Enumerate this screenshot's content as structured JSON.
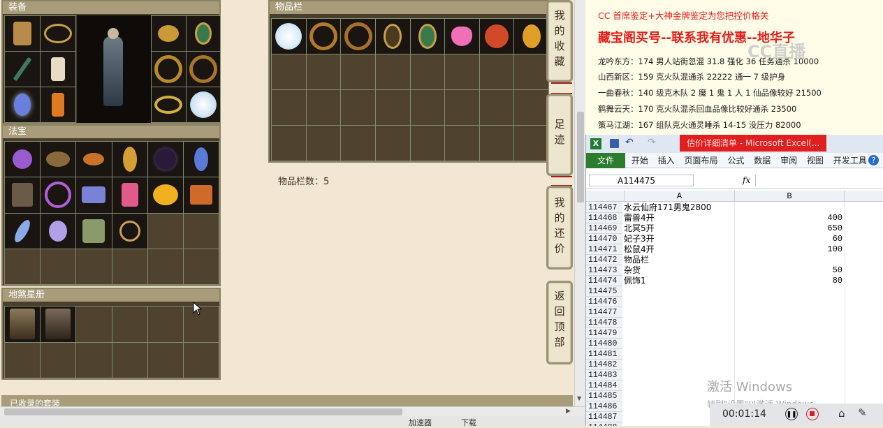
{
  "panels": {
    "equip": {
      "title": "装备"
    },
    "treasure": {
      "title": "法宝"
    },
    "star_book": {
      "title": "地煞星册"
    },
    "inventory": {
      "title": "物品栏",
      "count_text": "物品栏数：5"
    },
    "collected": {
      "title": "已收录的套装"
    }
  },
  "side_tabs": [
    {
      "label": "我\n的\n收\n藏"
    },
    {
      "label": "足\n迹"
    },
    {
      "label": "我\n的\n还\n价"
    },
    {
      "label": "返\n回\n顶\n部"
    }
  ],
  "doc": {
    "line_cc": "CC 首席鉴定+大神金牌鉴定为您把控价格关",
    "headline": "藏宝阁买号--联系我有优惠--地华子",
    "watermark": "CC直播",
    "entries": [
      "龙吟东方：174 男人站街忽混 31.8 强化 36 任务通杀 10000",
      "山西新区：159 克火队混通杀 22222 通一 7 级护身",
      "一曲春秋：140 级克木队 2 魔 1 鬼 1 人 1 仙品像较好 21500",
      "鹤舞云天：170 克火队混杀回血品像比较好通杀 23500",
      "策马江湖：167 组队克火通灵睡杀 14-15 没压力 82000"
    ]
  },
  "excel": {
    "title": "估价详细清单 - Microsoft Excel(...",
    "ribbon_tabs": [
      "开始",
      "插入",
      "页面布局",
      "公式",
      "数据",
      "审阅",
      "视图",
      "开发工具"
    ],
    "file_tab": "文件",
    "name_box": "A114475",
    "fx": "fx",
    "col_a": "A",
    "col_b": "B",
    "rows": [
      {
        "n": "114467",
        "a": "水云仙府171男鬼2800",
        "b": ""
      },
      {
        "n": "114468",
        "a": "雷兽4开",
        "b": "400"
      },
      {
        "n": "114469",
        "a": "北冥5开",
        "b": "650"
      },
      {
        "n": "114470",
        "a": "妃子3开",
        "b": "60"
      },
      {
        "n": "114471",
        "a": "松鼠4开",
        "b": "100"
      },
      {
        "n": "114472",
        "a": "物品栏",
        "b": ""
      },
      {
        "n": "114473",
        "a": "杂货",
        "b": "50"
      },
      {
        "n": "114474",
        "a": "佩饰1",
        "b": "80"
      },
      {
        "n": "114475",
        "a": "",
        "b": ""
      },
      {
        "n": "114476",
        "a": "",
        "b": ""
      },
      {
        "n": "114477",
        "a": "",
        "b": ""
      },
      {
        "n": "114478",
        "a": "",
        "b": ""
      },
      {
        "n": "114479",
        "a": "",
        "b": ""
      },
      {
        "n": "114480",
        "a": "",
        "b": ""
      },
      {
        "n": "114481",
        "a": "",
        "b": ""
      },
      {
        "n": "114482",
        "a": "",
        "b": ""
      },
      {
        "n": "114483",
        "a": "",
        "b": ""
      },
      {
        "n": "114484",
        "a": "",
        "b": ""
      },
      {
        "n": "114485",
        "a": "",
        "b": ""
      },
      {
        "n": "114486",
        "a": "",
        "b": ""
      },
      {
        "n": "114487",
        "a": "",
        "b": ""
      },
      {
        "n": "114488",
        "a": "",
        "b": ""
      }
    ]
  },
  "windows_watermark": {
    "line1": "激活 Windows",
    "line2": "转到\"设置\"以激活 Windows。"
  },
  "recorder": {
    "time": "00:01:14"
  },
  "bottom_bar": {
    "speed": "加速器",
    "download": "下载"
  }
}
